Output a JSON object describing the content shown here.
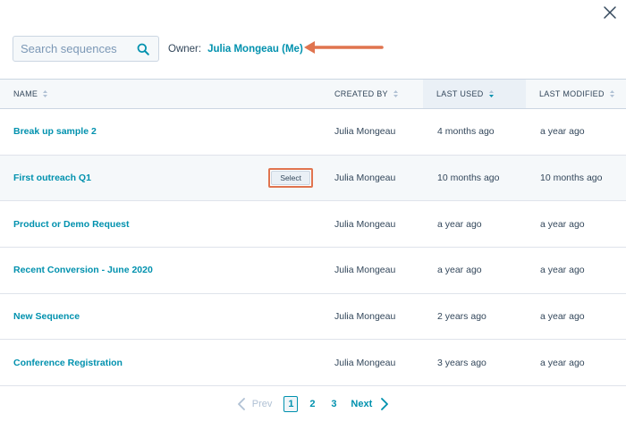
{
  "search": {
    "placeholder": "Search sequences",
    "value": ""
  },
  "owner": {
    "label": "Owner:",
    "value": "Julia Mongeau (Me)"
  },
  "columns": {
    "name": "NAME",
    "created_by": "CREATED BY",
    "last_used": "LAST USED",
    "last_modified": "LAST MODIFIED"
  },
  "sorted_column": "last_used",
  "rows": [
    {
      "name": "Break up sample 2",
      "created_by": "Julia Mongeau",
      "last_used": "4 months ago",
      "last_modified": "a year ago"
    },
    {
      "name": "First outreach Q1",
      "created_by": "Julia Mongeau",
      "last_used": "10 months ago",
      "last_modified": "10 months ago",
      "action": "Select"
    },
    {
      "name": "Product or Demo Request",
      "created_by": "Julia Mongeau",
      "last_used": "a year ago",
      "last_modified": "a year ago"
    },
    {
      "name": "Recent Conversion - June 2020",
      "created_by": "Julia Mongeau",
      "last_used": "a year ago",
      "last_modified": "a year ago"
    },
    {
      "name": "New Sequence",
      "created_by": "Julia Mongeau",
      "last_used": "2 years ago",
      "last_modified": "a year ago"
    },
    {
      "name": "Conference Registration",
      "created_by": "Julia Mongeau",
      "last_used": "3 years ago",
      "last_modified": "a year ago"
    }
  ],
  "pagination": {
    "prev_label": "Prev",
    "next_label": "Next",
    "pages": [
      "1",
      "2",
      "3"
    ],
    "current": "1"
  },
  "colors": {
    "link": "#0091ae",
    "annotation": "#e0744f",
    "header_bg": "#f5f8fa",
    "text": "#33475b"
  },
  "icons": {
    "close": "close-icon",
    "search": "search-icon",
    "sort": "sort-icon",
    "sort_active": "sort-descending-icon",
    "prev": "chevron-left-icon",
    "next": "chevron-right-icon",
    "annotation": "arrow-left-icon"
  }
}
